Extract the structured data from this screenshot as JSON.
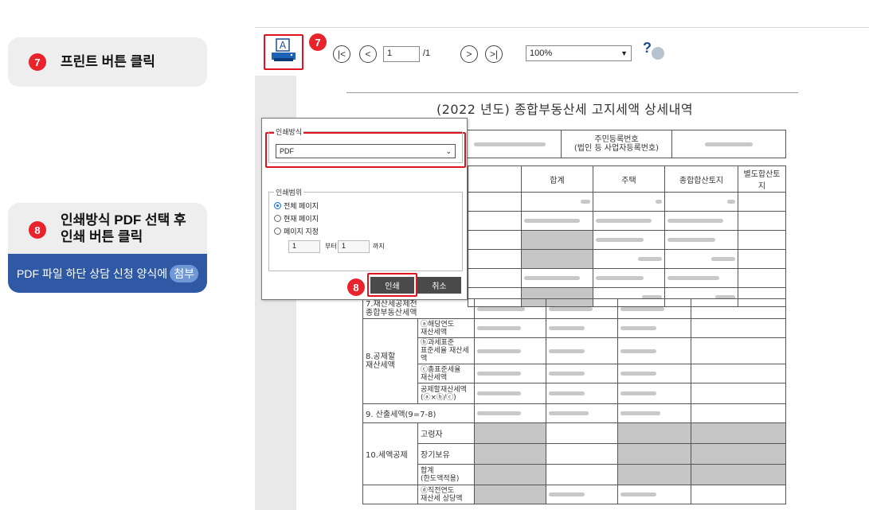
{
  "steps": {
    "step7": {
      "num": "7",
      "text": "프린트 버튼 클릭"
    },
    "step8": {
      "num": "8",
      "line1": "인쇄방식 PDF 선택 후",
      "line2": "인쇄 버튼 클릭",
      "note_prefix": "PDF 파일 하단 상담 신청 양식에",
      "note_pill": "첨부"
    }
  },
  "toolbar": {
    "print_icon_letter": "A",
    "marker7": "7",
    "page_input": "1",
    "page_total": "/1",
    "zoom": "100%",
    "help_icon": "?"
  },
  "document": {
    "title": "(2022 년도) 종합부동산세 고지세액 상세내역",
    "header_id_label": "주민등록번호\n(법인 등 사업자등록번호)",
    "columns": [
      "합계",
      "주택",
      "종합합산토지",
      "별도합산토지"
    ],
    "row7": "7.재산세공제전\n종합부동산세액",
    "row8_label": "8.공제할\n재산세액",
    "row8_items": [
      "ⓐ해당연도\n재산세액",
      "ⓑ과세표준\n표준세율 재산세액",
      "ⓒ총표준세율\n재산세액",
      "공제할재산세액\n(ⓐ×ⓑ/ⓒ)"
    ],
    "row9": "9. 산출세액(9=7-8)",
    "row10_label": "10.세액공제",
    "row10_items": [
      "고령자",
      "장기보유",
      "합계\n(한도액적용)"
    ],
    "row11_item": "ⓓ직전연도\n재산세 상당액"
  },
  "dialog": {
    "method_legend": "인쇄방식",
    "method_value": "PDF",
    "range_legend": "인쇄범위",
    "options": [
      "전체 페이지",
      "현재 페이지",
      "페이지 지정"
    ],
    "from_value": "1",
    "from_label": "부터",
    "to_value": "1",
    "to_label": "까지",
    "print_label": "인쇄",
    "cancel_label": "취소",
    "marker8": "8"
  },
  "colors": {
    "accent_red": "#e8232c",
    "brand_blue": "#2f59a5"
  }
}
